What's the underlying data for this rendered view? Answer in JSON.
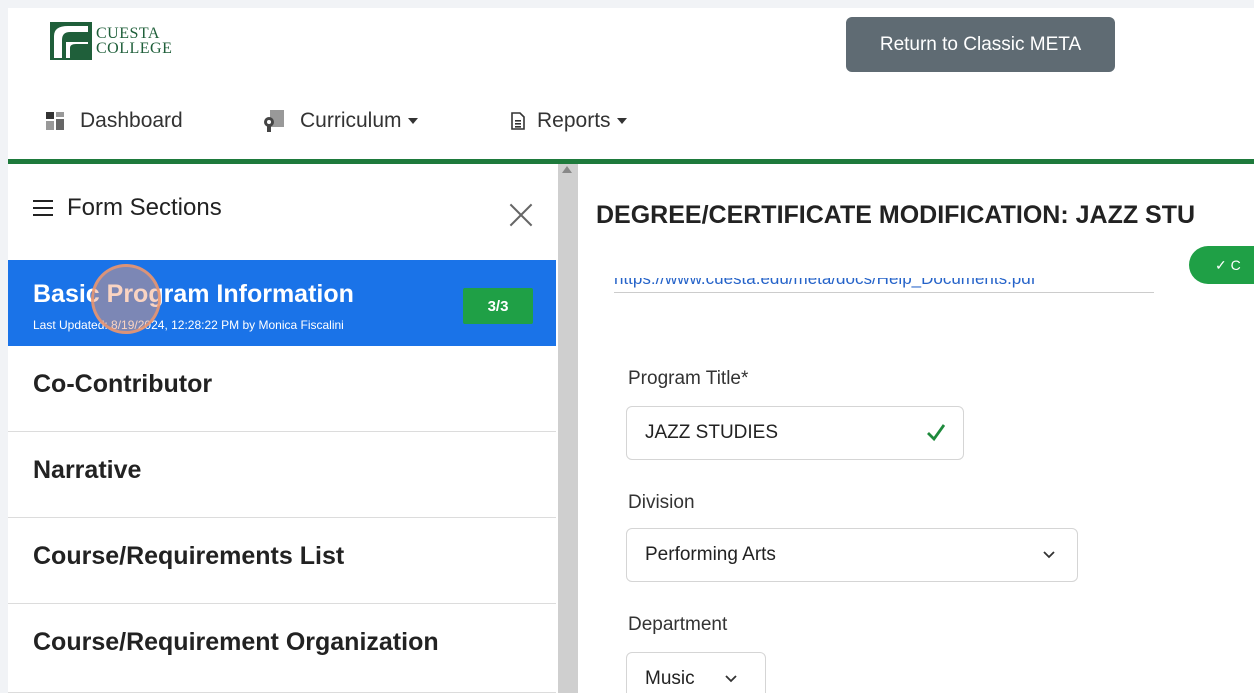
{
  "header": {
    "logo_line1": "CUESTA",
    "logo_line2": "COLLEGE",
    "classic_button": "Return to Classic META"
  },
  "nav": {
    "dashboard": "Dashboard",
    "curriculum": "Curriculum",
    "reports": "Reports"
  },
  "sidebar": {
    "title": "Form Sections",
    "active_section": {
      "title": "Basic Program Information",
      "updated": "Last Updated: 8/19/2024, 12:28:22 PM by Monica Fiscalini",
      "badge": "3/3"
    },
    "sections": [
      "Co-Contributor",
      "Narrative",
      "Course/Requirements List",
      "Course/Requirement Organization"
    ]
  },
  "main": {
    "title": "DEGREE/CERTIFICATE MODIFICATION: JAZZ STU",
    "status_text": "✓ C",
    "help_link": "https://www.cuesta.edu/meta/docs/Help_Documents.pdf",
    "program_title_label": "Program Title*",
    "program_title_value": "JAZZ STUDIES",
    "division_label": "Division",
    "division_value": "Performing Arts",
    "department_label": "Department",
    "department_value": "Music"
  },
  "colors": {
    "accent": "#1a73e8",
    "brand_green": "#1e7a3c",
    "success": "#1fa046"
  }
}
